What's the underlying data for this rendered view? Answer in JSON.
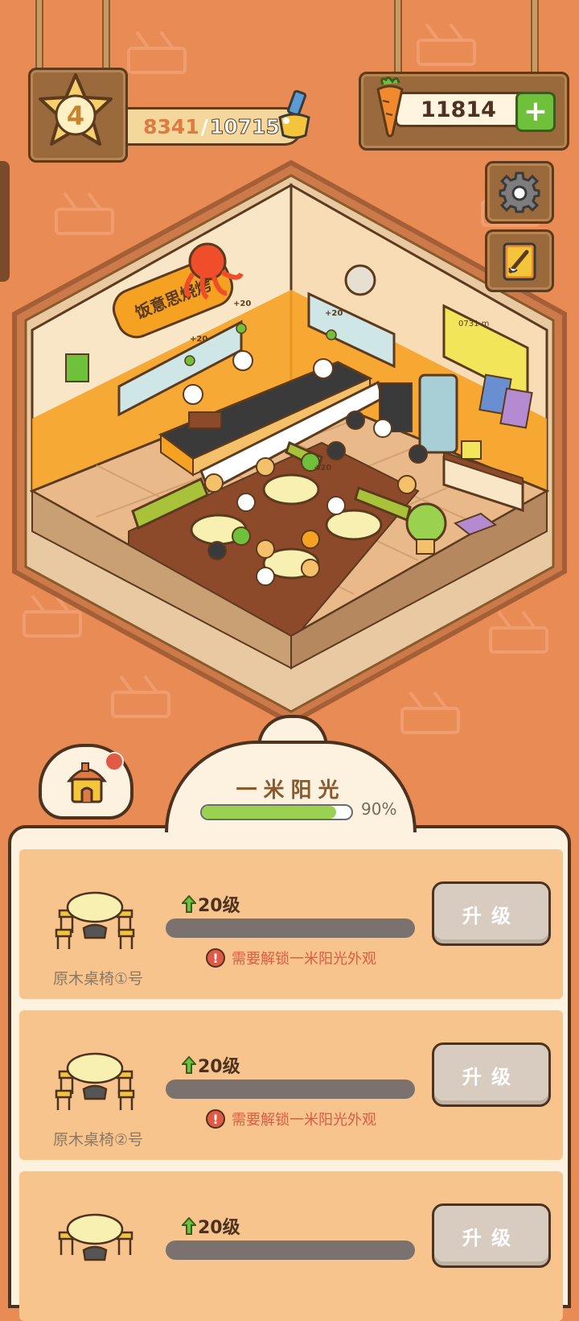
{
  "hud": {
    "player_level": "4",
    "xp_current": "8341",
    "xp_separator": "/",
    "xp_max": "10715",
    "carrot_count": "11814",
    "add_label": "+"
  },
  "restaurant": {
    "sign_text": "饭意思烧烤",
    "float_bonus": "+20",
    "menu_title": "0731 m"
  },
  "panel": {
    "title": "一米阳光",
    "progress_percent": 90,
    "progress_label": "90%"
  },
  "items": [
    {
      "name": "原木桌椅①号",
      "level": "20级",
      "warning": "需要解锁一米阳光外观",
      "button": "升级"
    },
    {
      "name": "原木桌椅②号",
      "level": "20级",
      "warning": "需要解锁一米阳光外观",
      "button": "升级"
    },
    {
      "name": "",
      "level": "20级",
      "warning": "",
      "button": "升级"
    }
  ],
  "colors": {
    "background": "#e88b55",
    "panel": "#fcf2df",
    "row": "#f6c48c",
    "accent_green": "#6fc03b",
    "warning_red": "#e05a46"
  },
  "icons": [
    "star-level-icon",
    "drink-icon",
    "carrot-icon",
    "plus-icon",
    "gear-icon",
    "recipe-book-icon",
    "house-icon",
    "table-set-icon",
    "up-arrow-icon",
    "warning-icon"
  ]
}
